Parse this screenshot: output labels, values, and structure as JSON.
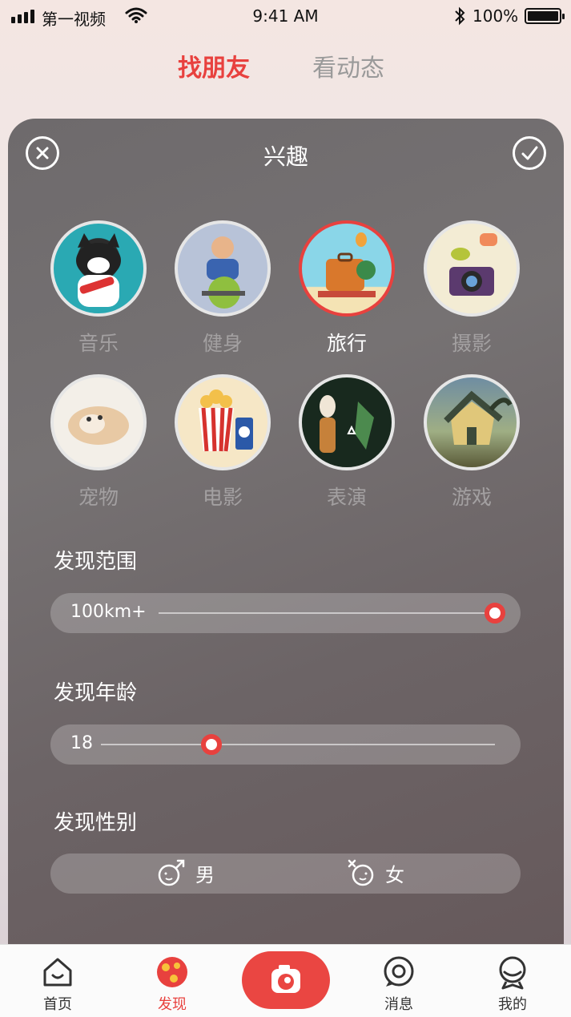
{
  "status_bar": {
    "carrier": "第一视频",
    "time": "9:41 AM",
    "battery": "100%",
    "battery_level": 1.0
  },
  "top_tabs": [
    {
      "label": "找朋友",
      "active": true
    },
    {
      "label": "看动态",
      "active": false
    }
  ],
  "panel": {
    "title": "兴趣",
    "close_icon": "close-circle-icon",
    "confirm_icon": "check-circle-icon",
    "interests": [
      {
        "label": "音乐",
        "selected": false,
        "color": "#2aa9b3"
      },
      {
        "label": "健身",
        "selected": false,
        "color": "#9eaec9"
      },
      {
        "label": "旅行",
        "selected": true,
        "color": "#7fd0e3"
      },
      {
        "label": "摄影",
        "selected": false,
        "color": "#f3ecd4"
      },
      {
        "label": "宠物",
        "selected": false,
        "color": "#f3efe8"
      },
      {
        "label": "电影",
        "selected": false,
        "color": "#f6e7c6"
      },
      {
        "label": "表演",
        "selected": false,
        "color": "#18291e"
      },
      {
        "label": "游戏",
        "selected": false,
        "color": "#8f9a72"
      }
    ],
    "range": {
      "title": "发现范围",
      "value": "100km+",
      "fraction": 1.0
    },
    "age": {
      "title": "发现年龄",
      "value": "18",
      "fraction": 0.28
    },
    "gender": {
      "title": "发现性别",
      "options": [
        {
          "label": "男",
          "icon": "male-icon"
        },
        {
          "label": "女",
          "icon": "female-icon"
        }
      ]
    }
  },
  "tab_bar": {
    "items": [
      {
        "label": "首页",
        "icon": "home-icon",
        "active": false
      },
      {
        "label": "发现",
        "icon": "discover-icon",
        "active": true
      },
      {
        "label": "消息",
        "icon": "message-icon",
        "active": false
      },
      {
        "label": "我的",
        "icon": "profile-icon",
        "active": false
      }
    ],
    "camera_icon": "camera-icon"
  },
  "colors": {
    "accent": "#e8413e"
  }
}
